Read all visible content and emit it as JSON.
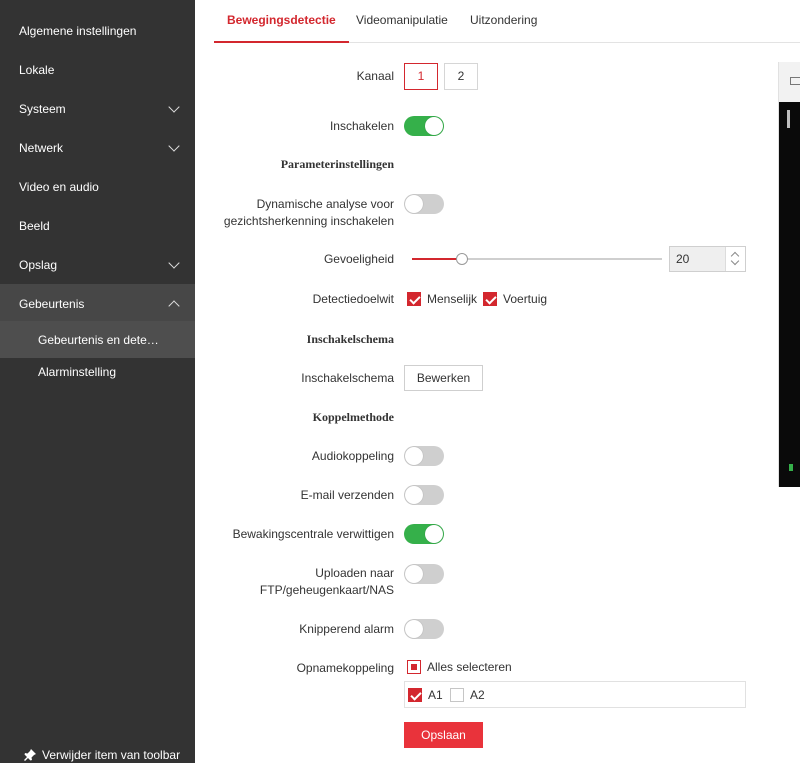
{
  "sidebar": {
    "items": [
      {
        "label": "Algemene instellingen"
      },
      {
        "label": "Lokale"
      },
      {
        "label": "Systeem"
      },
      {
        "label": "Netwerk"
      },
      {
        "label": "Video en audio"
      },
      {
        "label": "Beeld"
      },
      {
        "label": "Opslag"
      },
      {
        "label": "Gebeurtenis"
      }
    ],
    "subitems": [
      {
        "label": "Gebeurtenis en dete…"
      },
      {
        "label": "Alarminstelling"
      }
    ],
    "footer_label": "Verwijder item van toolbar"
  },
  "tabs": [
    {
      "label": "Bewegingsdetectie"
    },
    {
      "label": "Videomanipulatie"
    },
    {
      "label": "Uitzondering"
    }
  ],
  "form": {
    "kanaal_label": "Kanaal",
    "channels": [
      "1",
      "2"
    ],
    "inschakelen_label": "Inschakelen",
    "section_params": "Parameterinstellingen",
    "dyn_label_1": "Dynamische analyse voor",
    "dyn_label_2": "gezichtsherkenning inschakelen",
    "sensitivity_label": "Gevoeligheid",
    "sensitivity_value": "20",
    "detectiedoelwit_label": "Detectiedoelwit",
    "targets": [
      "Menselijk",
      "Voertuig"
    ],
    "section_schema": "Inschakelschema",
    "schema_label": "Inschakelschema",
    "edit_button": "Bewerken",
    "section_link": "Koppelmethode",
    "audio_label": "Audiokoppeling",
    "email_label": "E-mail verzenden",
    "bewaking_label": "Bewakingscentrale verwittigen",
    "upload_label_1": "Uploaden naar",
    "upload_label_2": "FTP/geheugenkaart/NAS",
    "knipper_label": "Knipperend alarm",
    "opname_label": "Opnamekoppeling",
    "select_all_label": "Alles selecteren",
    "recordings": [
      "A1",
      "A2"
    ],
    "save_button": "Opslaan"
  },
  "state": {
    "selected_channel": "1",
    "toggles": {
      "inschakelen": true,
      "dynamische_analyse": false,
      "audiokoppeling": false,
      "email_verzenden": false,
      "bewakingscentrale": true,
      "uploaden": false,
      "knipperend_alarm": false
    },
    "sensitivity_percent": 20,
    "targets_checked": {
      "Menselijk": true,
      "Voertuig": true
    },
    "recordings_checked": {
      "A1": true,
      "A2": false
    },
    "select_all": "partial"
  },
  "colors": {
    "accent": "#d3272e",
    "toggle_on": "#35b04a",
    "sidebar_bg": "#333333",
    "save_button_bg": "#e9333b"
  },
  "icons": {
    "chevron": "chevron-icon",
    "pin": "pin-icon"
  }
}
